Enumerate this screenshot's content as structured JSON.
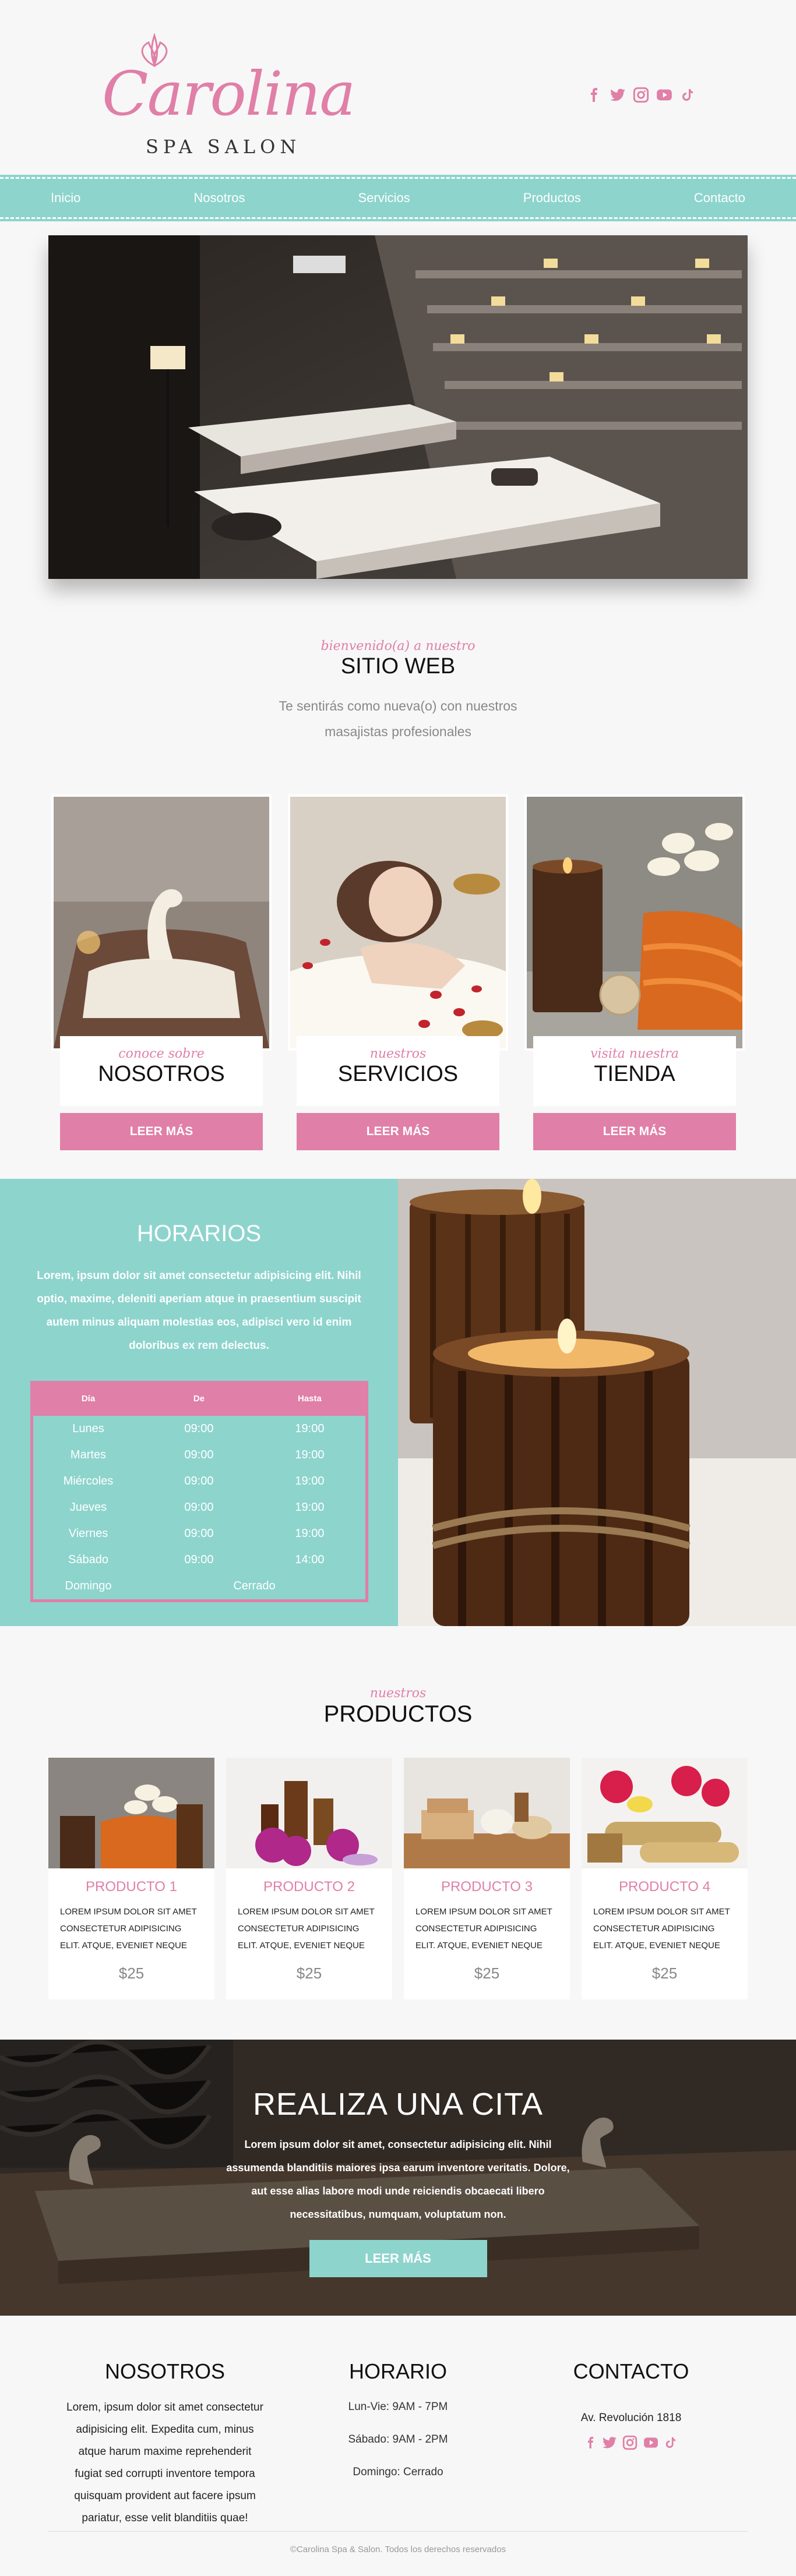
{
  "brand": {
    "name": "Carolina",
    "tagline": "SPA SALON"
  },
  "social": {
    "icons": [
      "facebook-icon",
      "twitter-icon",
      "instagram-icon",
      "youtube-icon",
      "tiktok-icon"
    ],
    "color": "#e07fa7"
  },
  "nav": {
    "items": [
      "Inicio",
      "Nosotros",
      "Servicios",
      "Productos",
      "Contacto"
    ]
  },
  "colors": {
    "pink": "#e07fa7",
    "teal": "#8dd4cd"
  },
  "intro": {
    "script": "bienvenido(a) a nuestro",
    "title": "SITIO WEB",
    "line1": "Te sentirás como nueva(o) con nuestros",
    "line2": "masajistas profesionales"
  },
  "cards": [
    {
      "script": "conoce sobre",
      "title": "NOSOTROS",
      "button": "LEER MÁS"
    },
    {
      "script": "nuestros",
      "title": "SERVICIOS",
      "button": "LEER MÁS"
    },
    {
      "script": "visita nuestra",
      "title": "TIENDA",
      "button": "LEER MÁS"
    }
  ],
  "horarios": {
    "title": "HORARIOS",
    "text": "Lorem, ipsum dolor sit amet consectetur adipisicing elit. Nihil optio, maxime, deleniti aperiam atque in praesentium suscipit autem minus aliquam molestias eos, adipisci vero id enim doloribus ex rem delectus.",
    "headers": [
      "Día",
      "De",
      "Hasta"
    ],
    "rows": [
      {
        "day": "Lunes",
        "from": "09:00",
        "to": "19:00"
      },
      {
        "day": "Martes",
        "from": "09:00",
        "to": "19:00"
      },
      {
        "day": "Miércoles",
        "from": "09:00",
        "to": "19:00"
      },
      {
        "day": "Jueves",
        "from": "09:00",
        "to": "19:00"
      },
      {
        "day": "Viernes",
        "from": "09:00",
        "to": "19:00"
      },
      {
        "day": "Sábado",
        "from": "09:00",
        "to": "14:00"
      }
    ],
    "closed": {
      "day": "Domingo",
      "label": "Cerrado"
    }
  },
  "productos": {
    "script": "nuestros",
    "title": "PRODUCTOS",
    "items": [
      {
        "name": "PRODUCTO 1",
        "text": "LOREM IPSUM DOLOR SIT AMET CONSECTETUR ADIPISICING ELIT. ATQUE, EVENIET NEQUE",
        "price": "$25"
      },
      {
        "name": "PRODUCTO 2",
        "text": "LOREM IPSUM DOLOR SIT AMET CONSECTETUR ADIPISICING ELIT. ATQUE, EVENIET NEQUE",
        "price": "$25"
      },
      {
        "name": "PRODUCTO 3",
        "text": "LOREM IPSUM DOLOR SIT AMET CONSECTETUR ADIPISICING ELIT. ATQUE, EVENIET NEQUE",
        "price": "$25"
      },
      {
        "name": "PRODUCTO 4",
        "text": "LOREM IPSUM DOLOR SIT AMET CONSECTETUR ADIPISICING ELIT. ATQUE, EVENIET NEQUE",
        "price": "$25"
      }
    ]
  },
  "cita": {
    "title": "REALIZA UNA CITA",
    "text": "Lorem ipsum dolor sit amet, consectetur adipisicing elit. Nihil assumenda blanditiis maiores ipsa earum inventore veritatis. Dolore, aut esse alias labore modi unde reiciendis obcaecati libero necessitatibus, numquam, voluptatum non.",
    "button": "LEER MÁS"
  },
  "footer": {
    "nosotros": {
      "title": "NOSOTROS",
      "text": "Lorem, ipsum dolor sit amet consectetur adipisicing elit. Expedita cum, minus atque harum maxime reprehenderit fugiat sed corrupti inventore tempora quisquam provident aut facere ipsum pariatur, esse velit blanditiis quae!"
    },
    "horario": {
      "title": "HORARIO",
      "line1": "Lun-Vie: 9AM - 7PM",
      "line2": "Sábado: 9AM - 2PM",
      "line3": "Domingo: Cerrado"
    },
    "contacto": {
      "title": "CONTACTO",
      "address": "Av. Revolución 1818"
    },
    "copyright": "©Carolina Spa & Salon. Todos los derechos reservados"
  }
}
